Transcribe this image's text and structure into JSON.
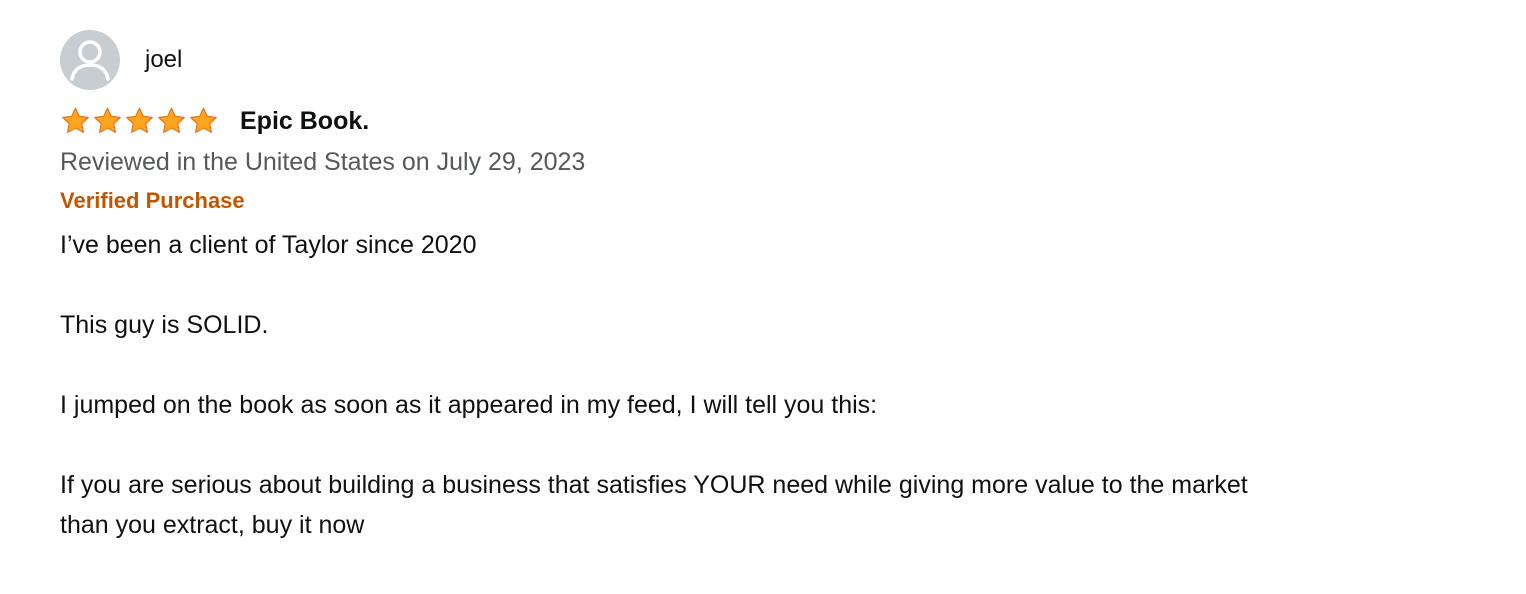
{
  "review": {
    "profile_name": "joel",
    "rating": 5,
    "rating_max": 5,
    "title": "Epic Book.",
    "date_line": "Reviewed in the United States on July 29, 2023",
    "badge": "Verified Purchase",
    "body": {
      "p1": "I’ve been a client of Taylor since 2020",
      "p2": "This guy is SOLID.",
      "p3": "I jumped on the book as soon as it appeared in my feed, I will tell you this:",
      "p4_line1": "If you are serious about building a business that satisfies YOUR need while giving more value to the market",
      "p4_line2": "than you extract, buy it now"
    }
  },
  "icons": {
    "avatar": "avatar-icon",
    "star": "star-icon"
  },
  "colors": {
    "star_fill": "#ffa41c",
    "star_stroke": "#de7921",
    "badge": "#c45500",
    "meta_text": "#565959",
    "avatar_bg": "#c7cdd0"
  }
}
